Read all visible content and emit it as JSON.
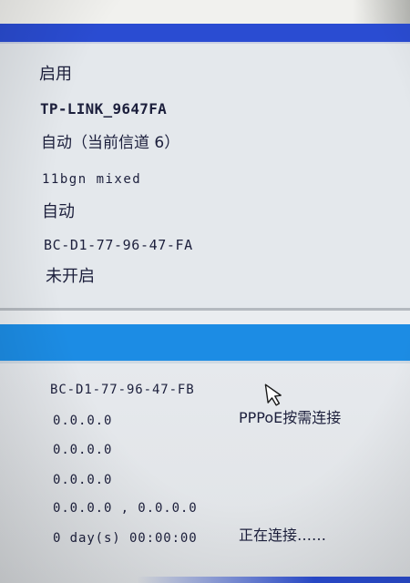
{
  "wireless": {
    "status": "启用",
    "ssid": "TP-LINK_9647FA",
    "channel": "自动（当前信道 6）",
    "mode": "11bgn mixed",
    "bandwidth": "自动",
    "mac": "BC-D1-77-96-47-FA",
    "wds": "未开启"
  },
  "wan": {
    "mac": "BC-D1-77-96-47-FB",
    "ip": "0.0.0.0",
    "connection_type": "PPPoE按需连接",
    "subnet_mask": "0.0.0.0",
    "gateway": "0.0.0.0",
    "dns": "0.0.0.0 , 0.0.0.0",
    "uptime": "0 day(s) 00:00:00",
    "connection_status": "正在连接……"
  },
  "colors": {
    "top_strip": "#f1f1ee",
    "header_top": "#2a4cd2",
    "panel_bg": "#e4e8ec",
    "divider": "#b4b9bf",
    "header_mid": "#1c8ce4",
    "text": "#1c1f3c"
  },
  "icons": {
    "cursor": "mouse-pointer-icon"
  }
}
